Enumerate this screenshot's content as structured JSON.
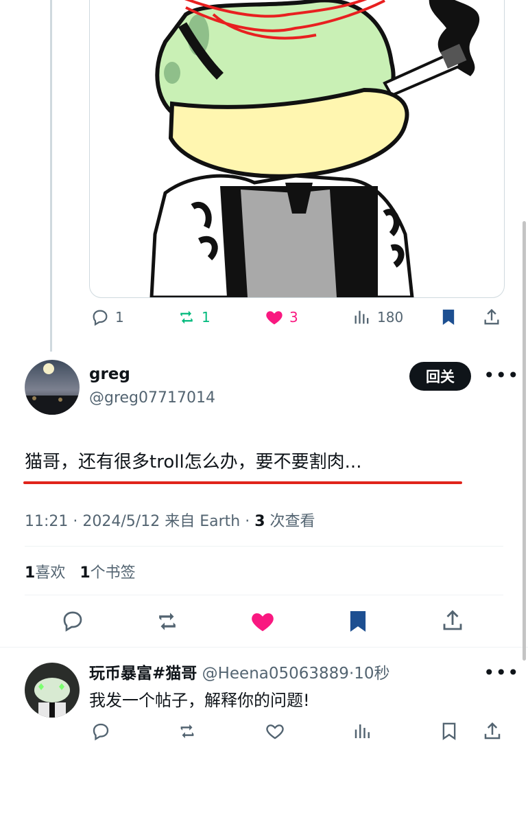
{
  "parent_tweet": {
    "reply_count": "1",
    "retweet_count": "1",
    "like_count": "3",
    "view_count": "180"
  },
  "main_tweet": {
    "display_name": "greg",
    "handle": "@greg07717014",
    "follow_label": "回关",
    "text": "猫哥，还有很多troll怎么办，要不要割肉...",
    "time": "11:21",
    "date": "2024/5/12",
    "source": "来自 Earth",
    "views_count": "3",
    "views_label": "次查看",
    "likes_count": "1",
    "likes_label": "喜欢",
    "bookmarks_count": "1",
    "bookmarks_label": "个书签"
  },
  "reply": {
    "display_name": "玩币暴富#猫哥",
    "handle": "@Heena05063889",
    "time": "10秒",
    "text": "我发一个帖子，解释你的问题!"
  },
  "colors": {
    "like_active": "#f91880",
    "retweet_active": "#00ba7c",
    "bookmark_active": "#1d4f91",
    "text_secondary": "#536471",
    "underline_red": "#e0241b"
  }
}
